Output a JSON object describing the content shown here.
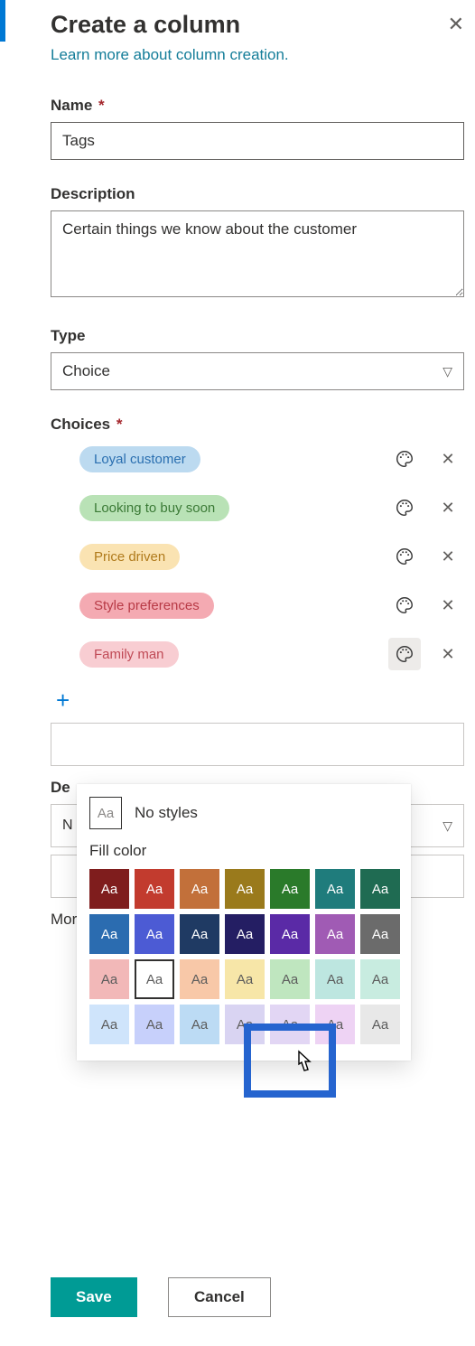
{
  "header": {
    "title": "Create a column",
    "learn_link": "Learn more about column creation."
  },
  "name_field": {
    "label": "Name",
    "value": "Tags"
  },
  "description_field": {
    "label": "Description",
    "value": "Certain things we know about the customer"
  },
  "type_field": {
    "label": "Type",
    "value": "Choice"
  },
  "choices_label": "Choices",
  "choices": [
    {
      "label": "Loyal customer",
      "style": "pill-blue"
    },
    {
      "label": "Looking to buy soon",
      "style": "pill-green"
    },
    {
      "label": "Price driven",
      "style": "pill-gold"
    },
    {
      "label": "Style preferences",
      "style": "pill-pink"
    },
    {
      "label": "Family man",
      "style": "pill-rose"
    }
  ],
  "partial_labels": {
    "de": "De",
    "dd_value": "N"
  },
  "more_options": "More options",
  "footer": {
    "save": "Save",
    "cancel": "Cancel"
  },
  "color_panel": {
    "no_styles_swatch": "Aa",
    "no_styles_label": "No styles",
    "fill_label": "Fill color",
    "rows": [
      [
        "#7f1d1d",
        "#c23b2e",
        "#c2703a",
        "#9a7a1c",
        "#2a7a2a",
        "#1f7c7c",
        "#1f6b52"
      ],
      [
        "#2b6cb0",
        "#4c5bd4",
        "#1f3a63",
        "#241e63",
        "#5a2aa6",
        "#a05bb4",
        "#6b6b6b"
      ],
      [
        "#f2b8b8",
        "#ffffff",
        "#f8c8a8",
        "#f7e6a8",
        "#bfe6bf",
        "#bde6e0",
        "#c8ece0"
      ],
      [
        "#cfe4fb",
        "#c7d0fb",
        "#bcdbf4",
        "#d9d4f2",
        "#e2d6f4",
        "#eed3f4",
        "#e8e8e8"
      ]
    ],
    "selected": {
      "row": 2,
      "col": 1
    }
  }
}
